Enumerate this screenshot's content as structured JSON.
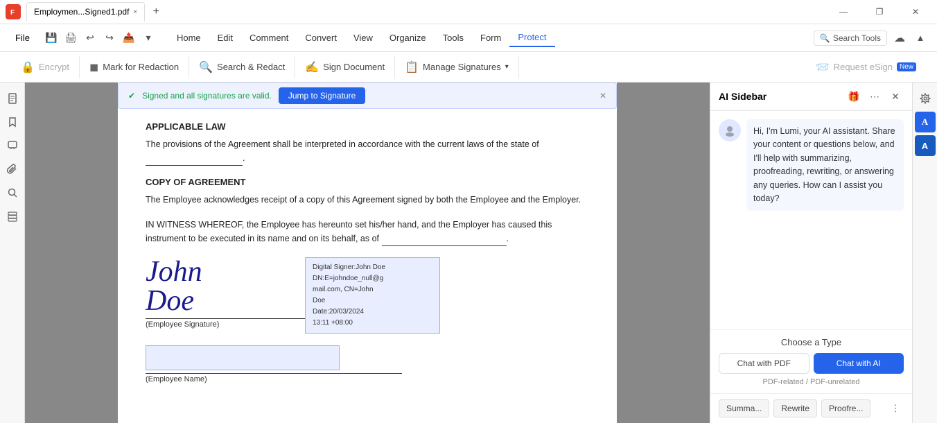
{
  "titlebar": {
    "app_icon": "F",
    "tab_title": "Employmen...Signed1.pdf",
    "close_tab": "×",
    "new_tab": "+",
    "win_minimize": "—",
    "win_restore": "❐",
    "win_close": "✕"
  },
  "menubar": {
    "file_label": "File",
    "icons": [
      "💾",
      "🖨",
      "↩",
      "↪",
      "📤",
      "▾"
    ],
    "items": [
      "Home",
      "Edit",
      "Comment",
      "Convert",
      "View",
      "Organize",
      "Tools",
      "Form",
      "Protect"
    ],
    "active_item": "Protect",
    "search_tools_label": "Search Tools",
    "cloud_icon": "☁",
    "expand_icon": "▲"
  },
  "protect_toolbar": {
    "encrypt_label": "Encrypt",
    "mark_redaction_label": "Mark for Redaction",
    "search_redact_label": "Search & Redact",
    "sign_document_label": "Sign Document",
    "manage_signatures_label": "Manage Signatures",
    "request_esign_label": "Request eSign",
    "request_esign_badge": "New"
  },
  "signature_banner": {
    "valid_text": "Signed and all signatures are valid.",
    "jump_button": "Jump to Signature",
    "close": "✕"
  },
  "pdf": {
    "section1_heading": "APPLICABLE LAW",
    "section1_para": "The provisions of the Agreement shall be interpreted in accordance with the current laws of the state of",
    "section2_heading": "COPY OF AGREEMENT",
    "section2_para": "The Employee acknowledges receipt of a copy of this Agreement signed by both the Employee and the Employer.",
    "section3_para": "IN WITNESS WHEREOF, the Employee has hereunto set his/her hand, and the Employer has caused this instrument to be executed in its name and on its behalf, as of",
    "signature_name": "John Doe",
    "sig_info_line1": "Digital Signer:John Doe",
    "sig_info_line2": "DN:E=johndoe_null@g",
    "sig_info_line3": "mail.com, CN=John",
    "sig_info_line4": "Doe",
    "sig_info_line5": "Date:20/03/2024",
    "sig_info_line6": "13:11 +08:00",
    "sig_label": "(Employee Signature)",
    "emp_name_label": "(Employee Name)"
  },
  "ai_sidebar": {
    "title": "AI Sidebar",
    "header_icons": [
      "🎁",
      "⋯",
      "✕"
    ],
    "avatar_icon": "👤",
    "message": "Hi, I'm Lumi, your AI assistant. Share your content or questions below, and I'll help with summarizing, proofreading, rewriting, or answering any queries. How can I assist you today?",
    "choose_type_label": "Choose a Type",
    "btn_chat_pdf_label": "Chat with PDF",
    "btn_chat_ai_label": "Chat with AI",
    "type_desc": "PDF-related / PDF-unrelated",
    "qa_buttons": [
      "Summa...",
      "Rewrite",
      "Proofre..."
    ],
    "qa_more": "⋮"
  },
  "left_sidebar_icons": [
    "□",
    "🔖",
    "💬",
    "📎",
    "🔍",
    "⊞"
  ],
  "right_panel_icons": [
    "⚙",
    "🅐",
    "🅐"
  ]
}
